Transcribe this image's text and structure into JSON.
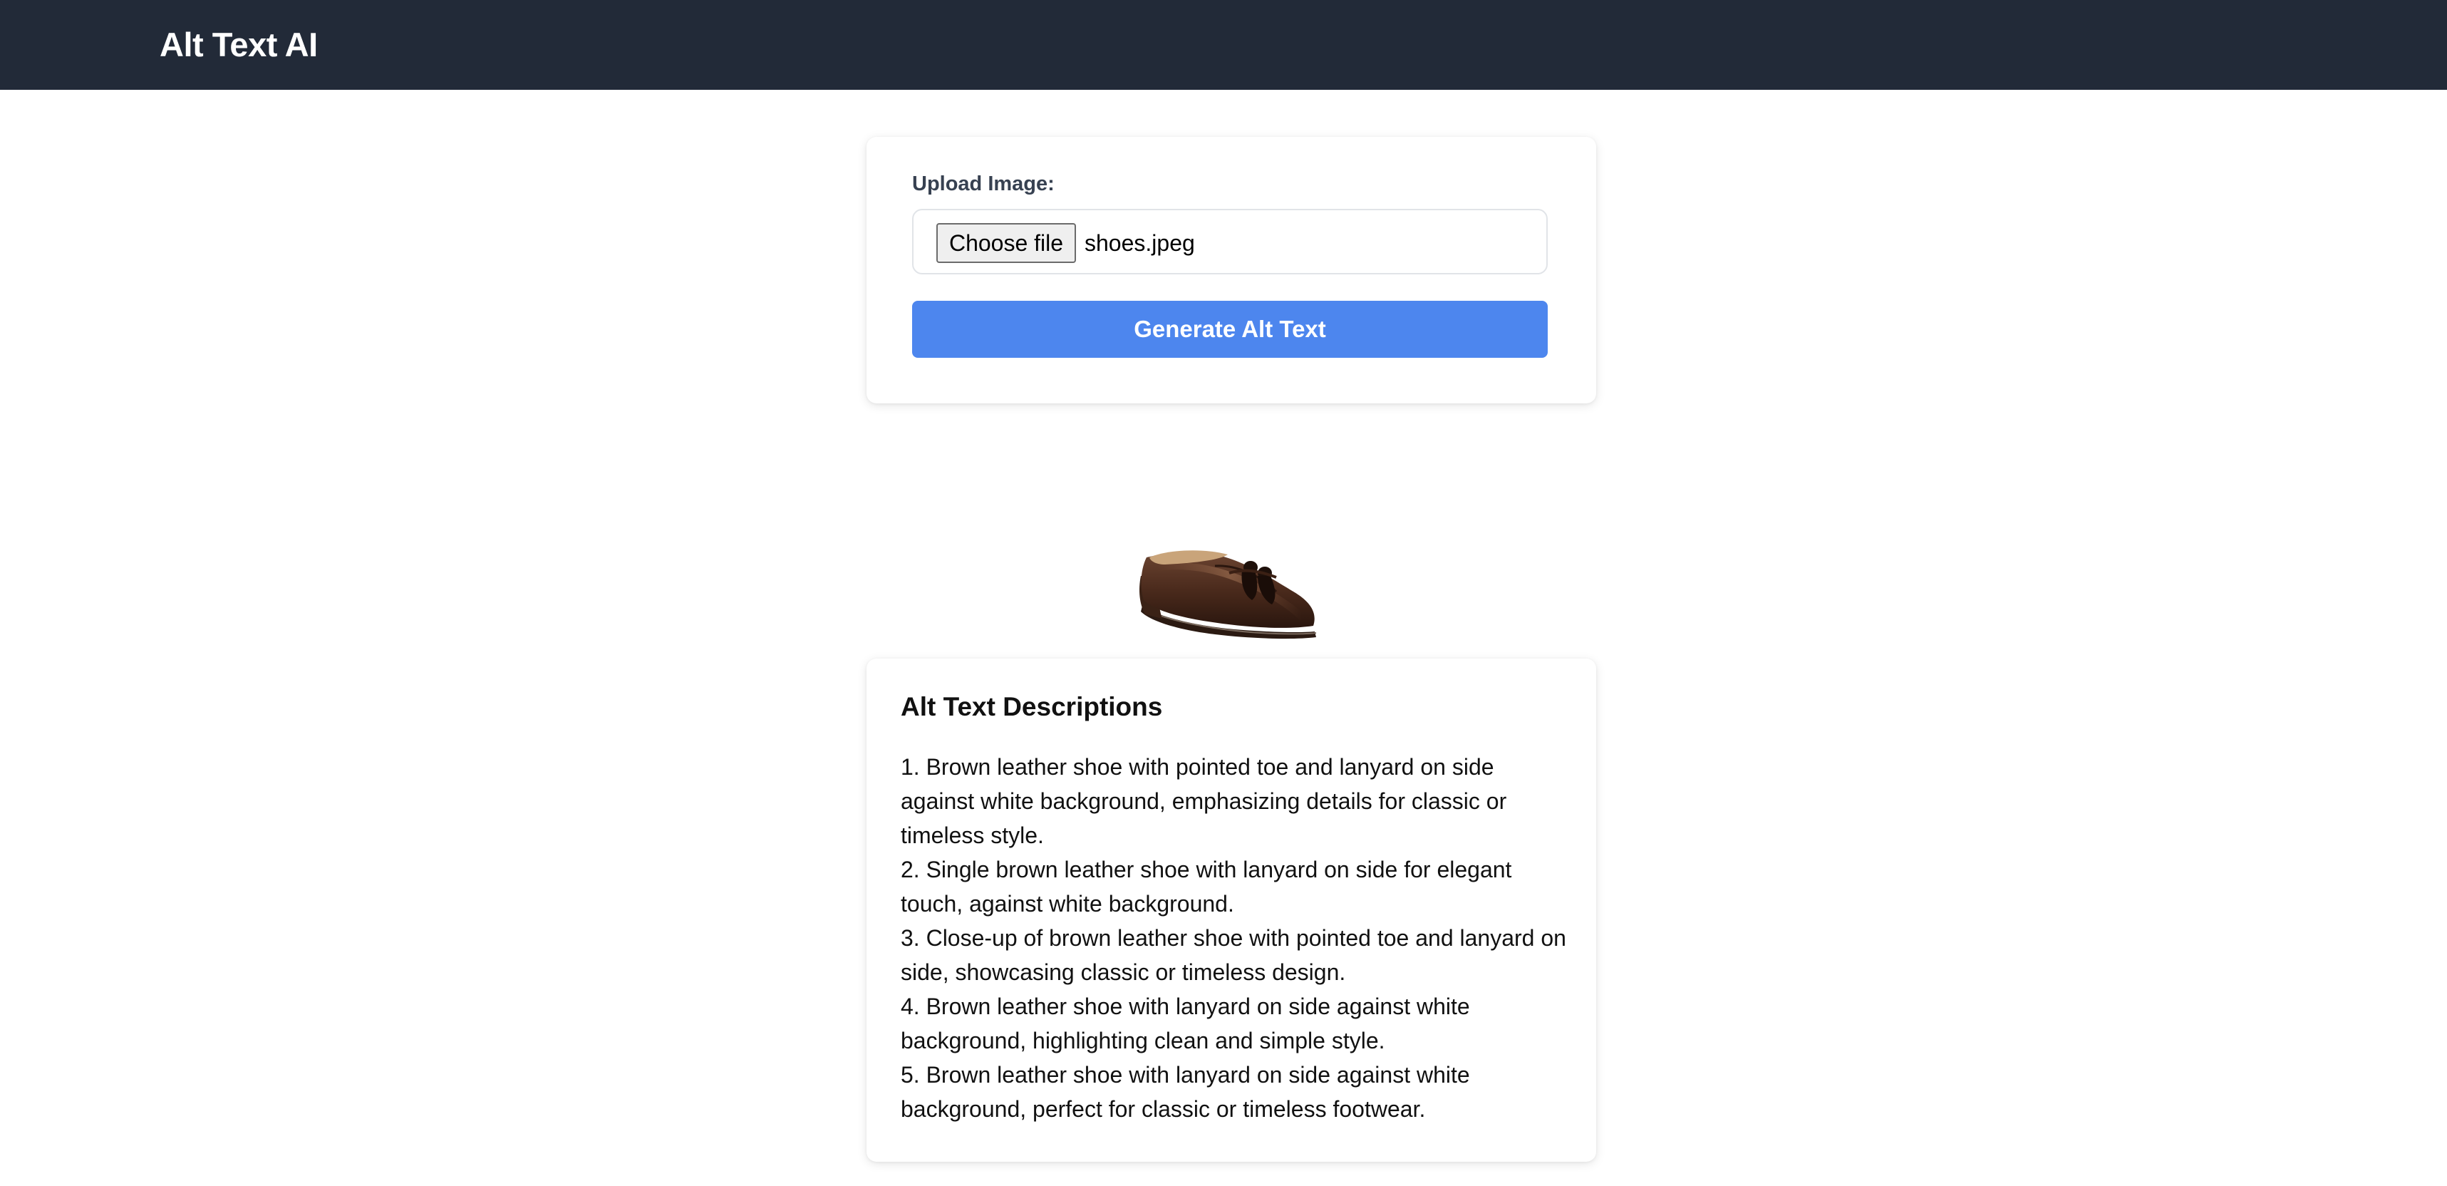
{
  "header": {
    "app_title": "Alt Text AI"
  },
  "upload": {
    "label": "Upload Image:",
    "choose_file_label": "Choose file",
    "file_name": "shoes.jpeg",
    "generate_label": "Generate Alt Text"
  },
  "preview": {
    "alt": "shoe"
  },
  "results": {
    "title": "Alt Text Descriptions",
    "items": [
      "1. Brown leather shoe with pointed toe and lanyard on side against white background, emphasizing details for classic or timeless style.",
      "2. Single brown leather shoe with lanyard on side for elegant touch, against white background.",
      "3. Close-up of brown leather shoe with pointed toe and lanyard on side, showcasing classic or timeless design.",
      "4. Brown leather shoe with lanyard on side against white background, highlighting clean and simple style.",
      "5. Brown leather shoe with lanyard on side against white background, perfect for classic or timeless footwear."
    ]
  },
  "colors": {
    "navbar": "#222a38",
    "primary_button": "#4d86ee",
    "label_text": "#374151"
  }
}
